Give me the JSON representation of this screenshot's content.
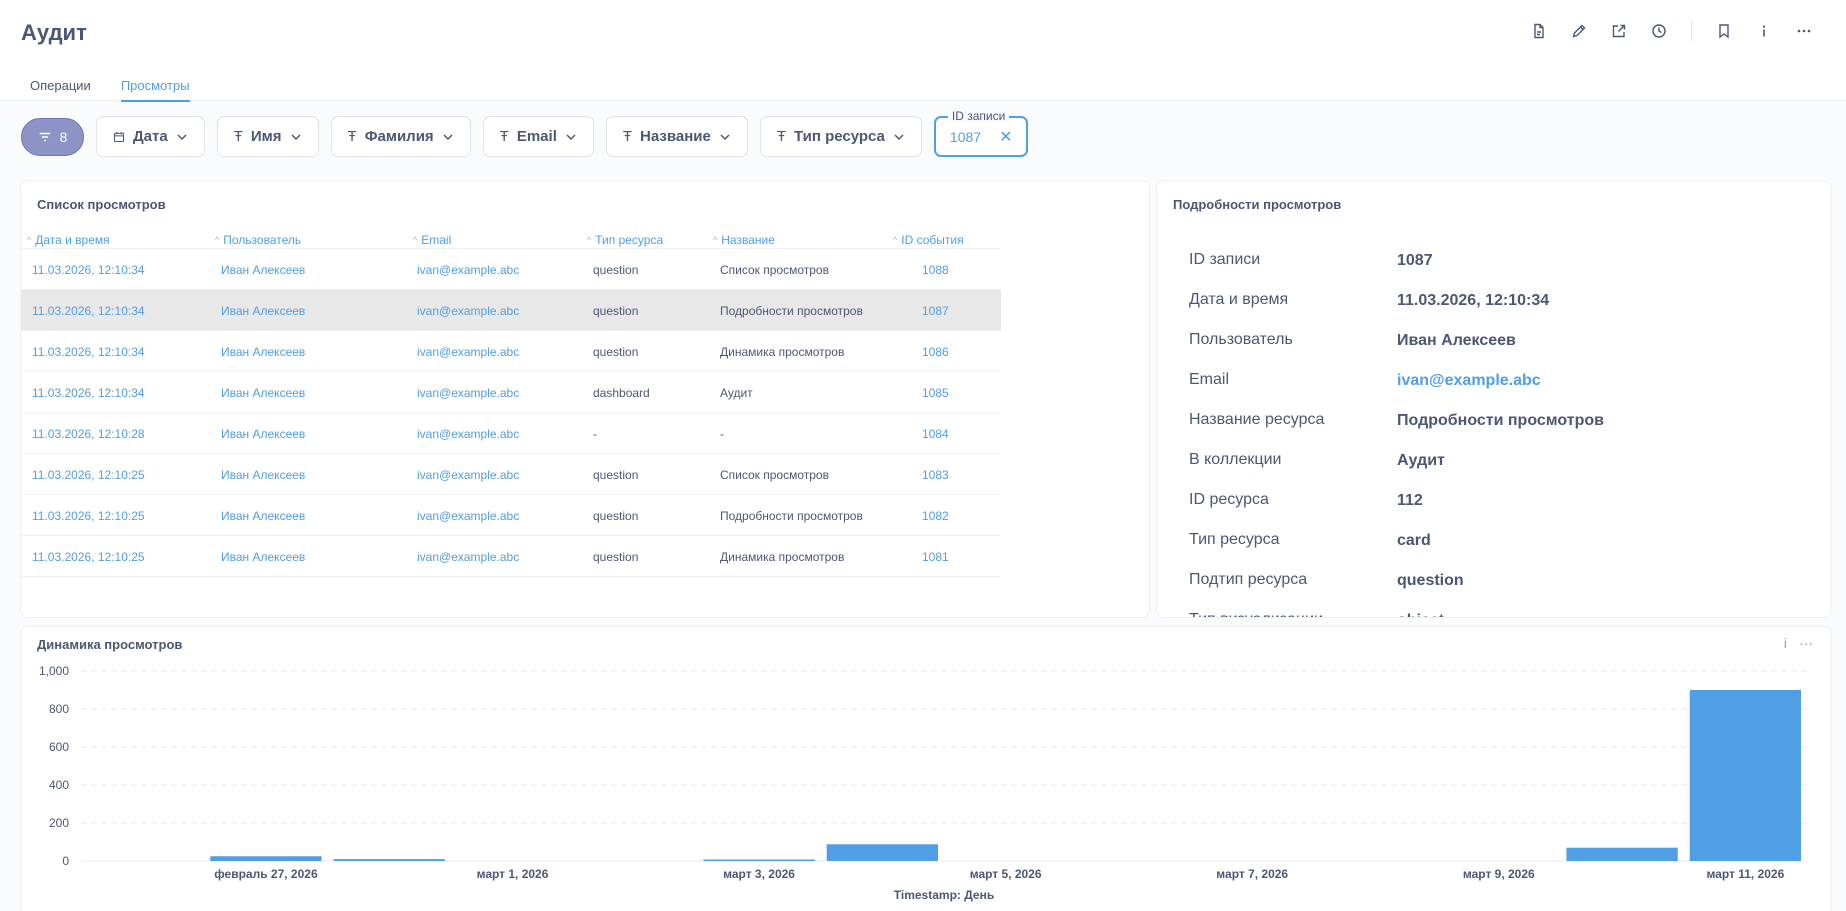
{
  "header": {
    "title": "Аудит",
    "tabs": [
      {
        "label": "Операции",
        "active": false
      },
      {
        "label": "Просмотры",
        "active": true
      }
    ]
  },
  "filters": {
    "count": "8",
    "items": [
      {
        "label": "Дата",
        "icon": "calendar-icon"
      },
      {
        "label": "Имя",
        "icon": "text-icon"
      },
      {
        "label": "Фамилия",
        "icon": "text-icon"
      },
      {
        "label": "Email",
        "icon": "text-icon"
      },
      {
        "label": "Название",
        "icon": "text-icon"
      },
      {
        "label": "Тип ресурса",
        "icon": "text-icon"
      }
    ],
    "id_filter": {
      "legend": "ID записи",
      "value": "1087"
    }
  },
  "list": {
    "title": "Список просмотров",
    "columns": [
      "Дата и время",
      "Пользователь",
      "Email",
      "Тип ресурса",
      "Название",
      "ID события"
    ],
    "rows": [
      {
        "datetime": "11.03.2026, 12:10:34",
        "user": "Иван Алексеев",
        "email": "ivan@example.abc",
        "type": "question",
        "name": "Список просмотров",
        "id": "1088",
        "selected": false
      },
      {
        "datetime": "11.03.2026, 12:10:34",
        "user": "Иван Алексеев",
        "email": "ivan@example.abc",
        "type": "question",
        "name": "Подробности просмотров",
        "id": "1087",
        "selected": true
      },
      {
        "datetime": "11.03.2026, 12:10:34",
        "user": "Иван Алексеев",
        "email": "ivan@example.abc",
        "type": "question",
        "name": "Динамика просмотров",
        "id": "1086",
        "selected": false
      },
      {
        "datetime": "11.03.2026, 12:10:34",
        "user": "Иван Алексеев",
        "email": "ivan@example.abc",
        "type": "dashboard",
        "name": "Аудит",
        "id": "1085",
        "selected": false
      },
      {
        "datetime": "11.03.2026, 12:10:28",
        "user": "Иван Алексеев",
        "email": "ivan@example.abc",
        "type": "-",
        "name": "-",
        "id": "1084",
        "selected": false
      },
      {
        "datetime": "11.03.2026, 12:10:25",
        "user": "Иван Алексеев",
        "email": "ivan@example.abc",
        "type": "question",
        "name": "Список просмотров",
        "id": "1083",
        "selected": false
      },
      {
        "datetime": "11.03.2026, 12:10:25",
        "user": "Иван Алексеев",
        "email": "ivan@example.abc",
        "type": "question",
        "name": "Подробности просмотров",
        "id": "1082",
        "selected": false
      },
      {
        "datetime": "11.03.2026, 12:10:25",
        "user": "Иван Алексеев",
        "email": "ivan@example.abc",
        "type": "question",
        "name": "Динамика просмотров",
        "id": "1081",
        "selected": false
      }
    ]
  },
  "details": {
    "title": "Подробности просмотров",
    "fields": [
      {
        "label": "ID записи",
        "value": "1087",
        "link": false
      },
      {
        "label": "Дата и время",
        "value": "11.03.2026, 12:10:34",
        "link": false
      },
      {
        "label": "Пользователь",
        "value": "Иван Алексеев",
        "link": false
      },
      {
        "label": "Email",
        "value": "ivan@example.abc",
        "link": true
      },
      {
        "label": "Название ресурса",
        "value": "Подробности просмотров",
        "link": false
      },
      {
        "label": "В коллекции",
        "value": "Аудит",
        "link": false
      },
      {
        "label": "ID ресурса",
        "value": "112",
        "link": false
      },
      {
        "label": "Тип ресурса",
        "value": "card",
        "link": false
      },
      {
        "label": "Подтип ресурса",
        "value": "question",
        "link": false
      },
      {
        "label": "Тип визуализации",
        "value": "object",
        "link": false
      }
    ]
  },
  "chart_data": {
    "type": "bar",
    "title": "Динамика просмотров",
    "xlabel": "Timestamp: День",
    "ylabel": "",
    "ylim": [
      0,
      1000
    ],
    "yticks": [
      "1,000",
      "800",
      "600",
      "400",
      "200",
      "0"
    ],
    "xticks": [
      "февраль 27, 2026",
      "март 1, 2026",
      "март 3, 2026",
      "март 5, 2026",
      "март 7, 2026",
      "март 9, 2026",
      "март 11, 2026"
    ],
    "x": [
      "2026-02-27",
      "2026-02-28",
      "2026-03-03",
      "2026-03-04",
      "2026-03-10",
      "2026-03-11"
    ],
    "values": [
      25,
      10,
      5,
      88,
      70,
      900
    ],
    "color": "#509ee3",
    "grid": true
  }
}
